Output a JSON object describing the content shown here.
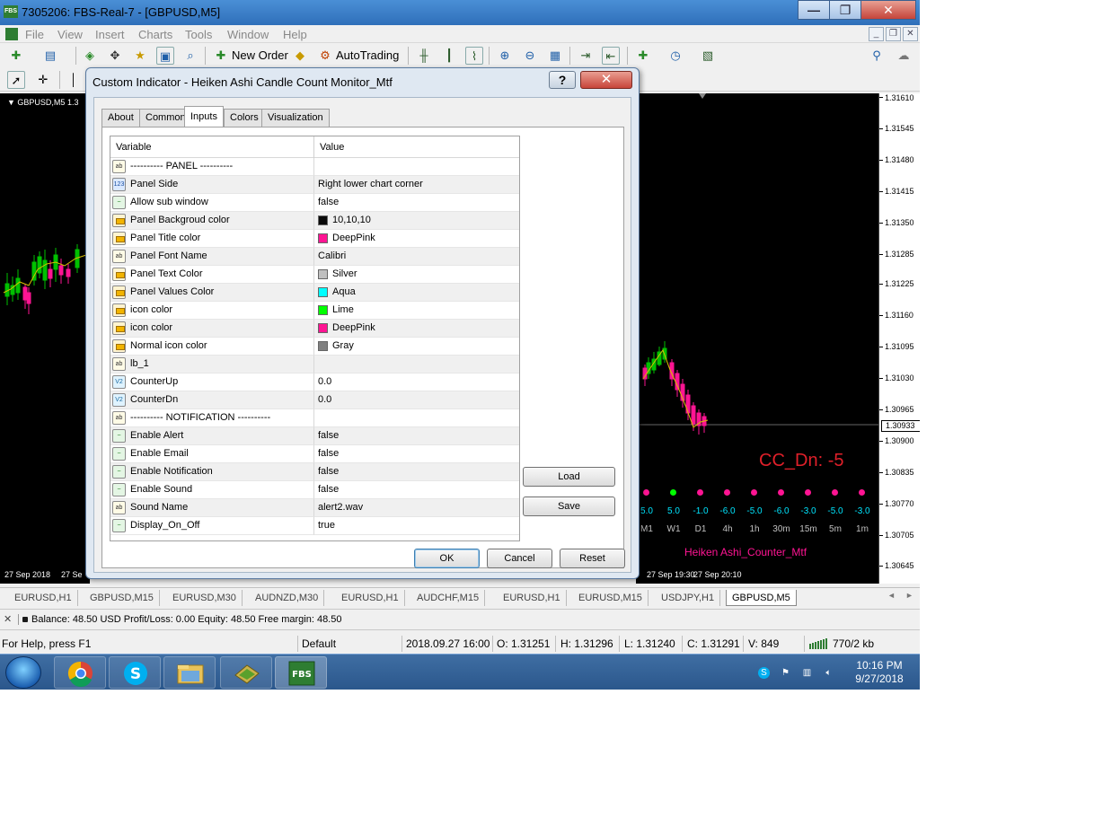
{
  "window": {
    "title": "7305206: FBS-Real-7 - [GBPUSD,M5]",
    "app_icon_text": "FBS",
    "min_glyph": "—",
    "max_glyph": "❐",
    "close_glyph": "✕"
  },
  "menu": {
    "items": [
      "File",
      "View",
      "Insert",
      "Charts",
      "Tools",
      "Window",
      "Help"
    ]
  },
  "toolbar": {
    "new_order": "New Order",
    "autotrading": "AutoTrading"
  },
  "chart": {
    "symbol_label": "GBPUSD,M5",
    "price_labels": [
      "1.31610",
      "1.31545",
      "1.31480",
      "1.31415",
      "1.31350",
      "1.31285",
      "1.31225",
      "1.31160",
      "1.31095",
      "1.31030",
      "1.30965",
      "1.30900",
      "1.30835",
      "1.30770",
      "1.30705",
      "1.30645"
    ],
    "current_price": "1.30933",
    "time_labels": [
      "27 Sep 2018",
      "27 Se",
      "27 Sep 19:30",
      "27 Sep 20:10"
    ]
  },
  "counter_panel": {
    "headline": "CC_Dn:  -5",
    "values": [
      "5.0",
      "5.0",
      "-1.0",
      "-6.0",
      "-5.0",
      "-6.0",
      "-3.0",
      "-5.0",
      "-3.0"
    ],
    "timeframes": [
      "M1",
      "W1",
      "D1",
      "4h",
      "1h",
      "30m",
      "15m",
      "5m",
      "1m"
    ],
    "dot_colors": [
      "#ff1493",
      "#00ff00",
      "#ff1493",
      "#ff1493",
      "#ff1493",
      "#ff1493",
      "#ff1493",
      "#ff1493",
      "#ff1493"
    ],
    "title": "Heiken Ashi_Counter_Mtf"
  },
  "dialog": {
    "title": "Custom Indicator - Heiken Ashi Candle Count Monitor_Mtf",
    "help_glyph": "?",
    "close_glyph": "✕",
    "tabs": [
      "About",
      "Common",
      "Inputs",
      "Colors",
      "Visualization"
    ],
    "active_tab": "Inputs",
    "grid": {
      "col_variable": "Variable",
      "col_value": "Value",
      "rows": [
        {
          "type": "ab",
          "icon": "ab",
          "name": "---------- PANEL ----------",
          "value": ""
        },
        {
          "type": "num",
          "icon": "123",
          "name": "Panel Side",
          "value": "Right lower chart corner"
        },
        {
          "type": "bool",
          "icon": "~",
          "name": "Allow sub window",
          "value": "false"
        },
        {
          "type": "color",
          "icon": "",
          "name": "Panel Backgroud color",
          "value": "10,10,10",
          "swatch": "#0a0a0a"
        },
        {
          "type": "color",
          "icon": "",
          "name": "Panel Title color",
          "value": "DeepPink",
          "swatch": "#ff1493"
        },
        {
          "type": "ab",
          "icon": "ab",
          "name": "Panel Font Name",
          "value": "Calibri"
        },
        {
          "type": "color",
          "icon": "",
          "name": "Panel Text Color",
          "value": "Silver",
          "swatch": "#c0c0c0"
        },
        {
          "type": "color",
          "icon": "",
          "name": "Panel Values Color",
          "value": "Aqua",
          "swatch": "#00ffff"
        },
        {
          "type": "color",
          "icon": "",
          "name": "icon color",
          "value": "Lime",
          "swatch": "#00ff00"
        },
        {
          "type": "color",
          "icon": "",
          "name": "icon color",
          "value": "DeepPink",
          "swatch": "#ff1493"
        },
        {
          "type": "color",
          "icon": "",
          "name": "Normal icon color",
          "value": "Gray",
          "swatch": "#808080"
        },
        {
          "type": "ab",
          "icon": "ab",
          "name": "lb_1",
          "value": ""
        },
        {
          "type": "dbl",
          "icon": "V2",
          "name": "CounterUp",
          "value": "0.0"
        },
        {
          "type": "dbl",
          "icon": "V2",
          "name": "CounterDn",
          "value": "0.0"
        },
        {
          "type": "ab",
          "icon": "ab",
          "name": "---------- NOTIFICATION ----------",
          "value": ""
        },
        {
          "type": "bool",
          "icon": "~",
          "name": "Enable Alert",
          "value": "false"
        },
        {
          "type": "bool",
          "icon": "~",
          "name": "Enable Email",
          "value": "false"
        },
        {
          "type": "bool",
          "icon": "~",
          "name": "Enable Notification",
          "value": "false"
        },
        {
          "type": "bool",
          "icon": "~",
          "name": "Enable Sound",
          "value": "false"
        },
        {
          "type": "ab",
          "icon": "ab",
          "name": "Sound Name",
          "value": "alert2.wav"
        },
        {
          "type": "bool",
          "icon": "~",
          "name": "Display_On_Off",
          "value": "true"
        }
      ]
    },
    "load_label": "Load",
    "save_label": "Save",
    "ok_label": "OK",
    "cancel_label": "Cancel",
    "reset_label": "Reset"
  },
  "window_tabs": {
    "items": [
      "EURUSD,H1",
      "GBPUSD,M15",
      "EURUSD,M30",
      "AUDNZD,M30",
      "EURUSD,H1",
      "AUDCHF,M15",
      "EURUSD,H1",
      "EURUSD,M15",
      "USDJPY,H1",
      "GBPUSD,M5"
    ],
    "active": "GBPUSD,M5",
    "scroll_left": "◄",
    "scroll_right": "►"
  },
  "terminal": {
    "close_glyph": "✕",
    "summary": "Balance: 48.50 USD  Profit/Loss: 0.00  Equity: 48.50  Free margin: 48.50"
  },
  "statusbar": {
    "help": "For Help, press F1",
    "profile": "Default",
    "datetime": "2018.09.27 16:00",
    "open": "O: 1.31251",
    "high": "H: 1.31296",
    "low": "L: 1.31240",
    "close": "C: 1.31291",
    "volume": "V: 849",
    "traffic": "770/2 kb"
  },
  "taskbar": {
    "clock_time": "10:16 PM",
    "clock_date": "9/27/2018",
    "fbs_label": "FBS"
  }
}
